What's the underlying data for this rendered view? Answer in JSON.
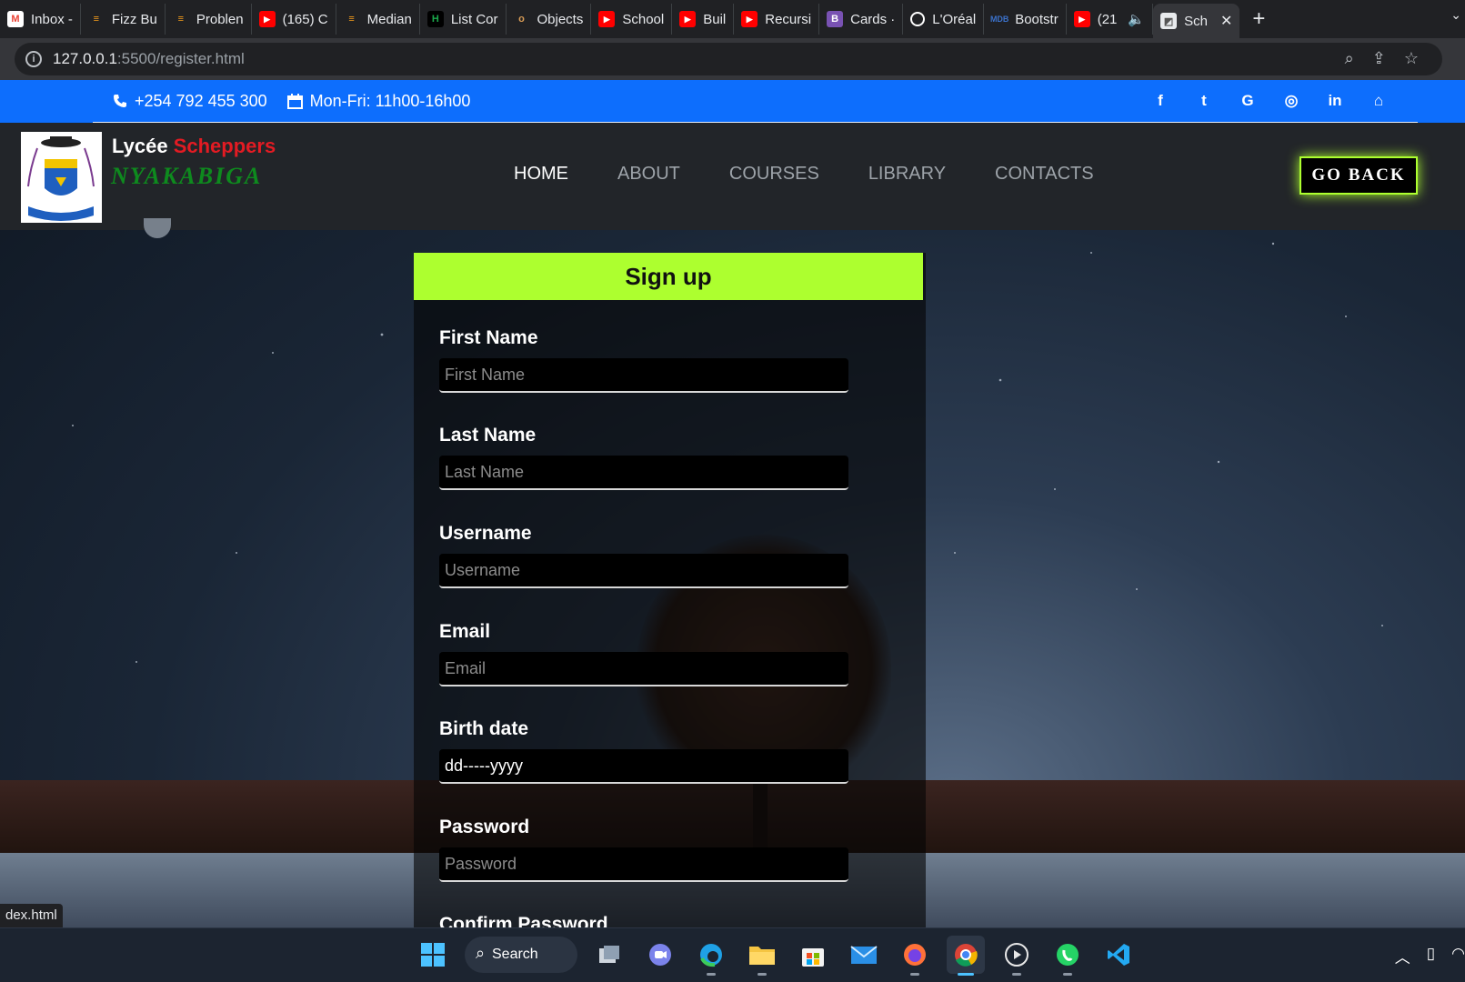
{
  "browser": {
    "tabs": [
      {
        "label": "Inbox -",
        "icon": "gmail-icon",
        "color": "#ea4335",
        "glyph": "M"
      },
      {
        "label": "Fizz Bu",
        "icon": "hackerrank-icon",
        "color": "#f89f1b",
        "glyph": "≡"
      },
      {
        "label": "Problen",
        "icon": "hackerrank-icon",
        "color": "#f89f1b",
        "glyph": "≡"
      },
      {
        "label": "(165) C",
        "icon": "youtube-icon",
        "color": "#ff0000",
        "glyph": "▶"
      },
      {
        "label": "Median",
        "icon": "hackerrank-icon",
        "color": "#f89f1b",
        "glyph": "≡"
      },
      {
        "label": "List Cor",
        "icon": "hackerrank-icon",
        "color": "#1ba94c",
        "glyph": "H"
      },
      {
        "label": "Objects",
        "icon": "owl-icon",
        "color": "#d89c55",
        "glyph": "o"
      },
      {
        "label": "School",
        "icon": "youtube-icon",
        "color": "#ff0000",
        "glyph": "▶"
      },
      {
        "label": "Buil",
        "icon": "youtube-icon",
        "color": "#ff0000",
        "glyph": "▶"
      },
      {
        "label": "Recursi",
        "icon": "youtube-icon",
        "color": "#ff0000",
        "glyph": "▶"
      },
      {
        "label": "Cards ·",
        "icon": "bootstrap-icon",
        "color": "#7952b3",
        "glyph": "B"
      },
      {
        "label": "L'Oréal",
        "icon": "loreal-icon",
        "color": "#000000",
        "glyph": "O"
      },
      {
        "label": "Bootstr",
        "icon": "mdb-icon",
        "color": "#3b71ca",
        "glyph": "M"
      },
      {
        "label": "(21",
        "icon": "youtube-icon",
        "color": "#ff0000",
        "glyph": "▶"
      }
    ],
    "active_tab": {
      "label": "Sch"
    },
    "url_host": "127.0.0.1",
    "url_rest": ":5500/register.html",
    "status_link": "dex.html"
  },
  "topbar": {
    "phone": "+254 792 455 300",
    "hours": "Mon-Fri: 11h00-16h00",
    "socials": [
      "f",
      "t",
      "G",
      "◎",
      "in",
      "⌂"
    ]
  },
  "navbar": {
    "brand_first": "Lycée",
    "brand_highlight": "Scheppers",
    "brand_sub": "NYAKABIGA",
    "menu": [
      "HOME",
      "ABOUT",
      "COURSES",
      "LIBRARY",
      "CONTACTS"
    ],
    "go_back": "GO BACK"
  },
  "form": {
    "title": "Sign up",
    "fields": [
      {
        "label": "First Name",
        "placeholder": "First Name",
        "value": ""
      },
      {
        "label": "Last Name",
        "placeholder": "Last Name",
        "value": ""
      },
      {
        "label": "Username",
        "placeholder": "Username",
        "value": ""
      },
      {
        "label": "Email",
        "placeholder": "Email",
        "value": ""
      },
      {
        "label": "Birth date",
        "placeholder": "dd-----yyyy",
        "value": "dd-----yyyy"
      },
      {
        "label": "Password",
        "placeholder": "Password",
        "value": ""
      },
      {
        "label": "Confirm Password",
        "placeholder": "",
        "value": ""
      }
    ]
  },
  "taskbar": {
    "search_label": "Search"
  },
  "colors": {
    "accent_green": "#adff2f",
    "topbar_blue": "#0d6efd",
    "brand_red": "#e31b23",
    "brand_green": "#0e8a1e"
  }
}
